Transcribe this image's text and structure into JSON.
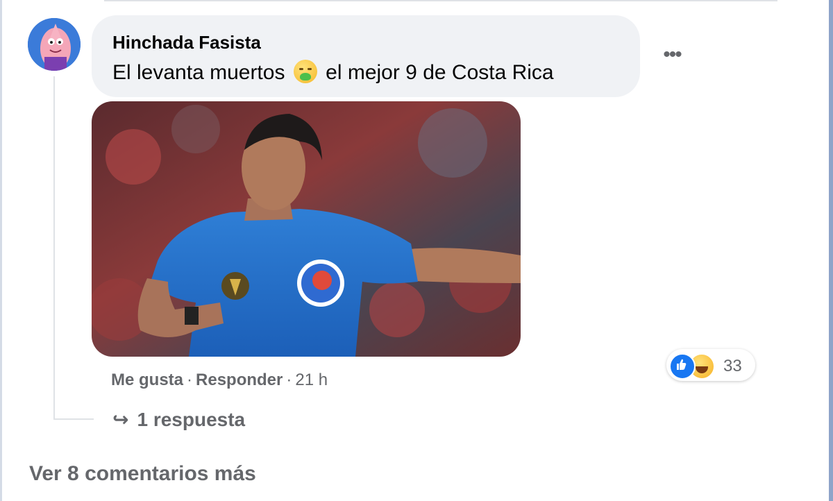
{
  "comment": {
    "author": "Hinchada Fasista",
    "text_before_emoji": "El levanta muertos",
    "emoji": "nauseated-face-emoji",
    "text_after_emoji": "el mejor 9 de Costa Rica",
    "more_label": "•••",
    "actions": {
      "like": "Me gusta",
      "separator": "·",
      "reply": "Responder",
      "time": "21 h"
    },
    "reactions": {
      "icons": [
        "like-icon",
        "haha-icon"
      ],
      "count": "33"
    },
    "replies_label": "1 respuesta"
  },
  "view_more_label": "Ver 8 comentarios más",
  "colors": {
    "bubble": "#f0f2f5",
    "secondary_text": "#65676b",
    "primary_text": "#050505",
    "like_blue": "#1877f2"
  }
}
